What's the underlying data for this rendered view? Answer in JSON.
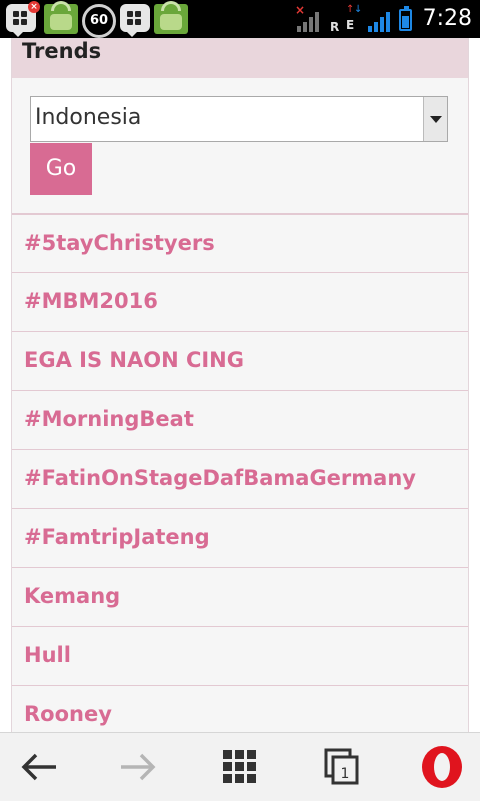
{
  "status_bar": {
    "icons": [
      "bbm-icon",
      "store-icon",
      "data-saver-60-icon",
      "bbm-icon",
      "store-icon",
      "no-signal-icon",
      "roaming-icon",
      "edge-data-icon",
      "signal-icon",
      "battery-icon"
    ],
    "counter": "60",
    "roaming_letter": "R",
    "network_letter": "E",
    "time": "7:28"
  },
  "trends": {
    "title": "Trends",
    "country_select": {
      "value": "Indonesia"
    },
    "go_label": "Go",
    "items": [
      "#5tayChristyers",
      "#MBM2016",
      "EGA IS NAON CING",
      "#MorningBeat",
      "#FatinOnStageDafBamaGermany",
      "#FamtripJateng",
      "Kemang",
      "Hull",
      "Rooney"
    ]
  },
  "browser_bar": {
    "tabs_count": "1",
    "buttons": [
      "back-icon",
      "forward-icon",
      "speed-dial-icon",
      "tabs-icon",
      "opera-icon"
    ]
  },
  "colors": {
    "accent": "#d86b93",
    "header_bg": "#e9d6dc",
    "status_bar_bg": "#000000"
  }
}
